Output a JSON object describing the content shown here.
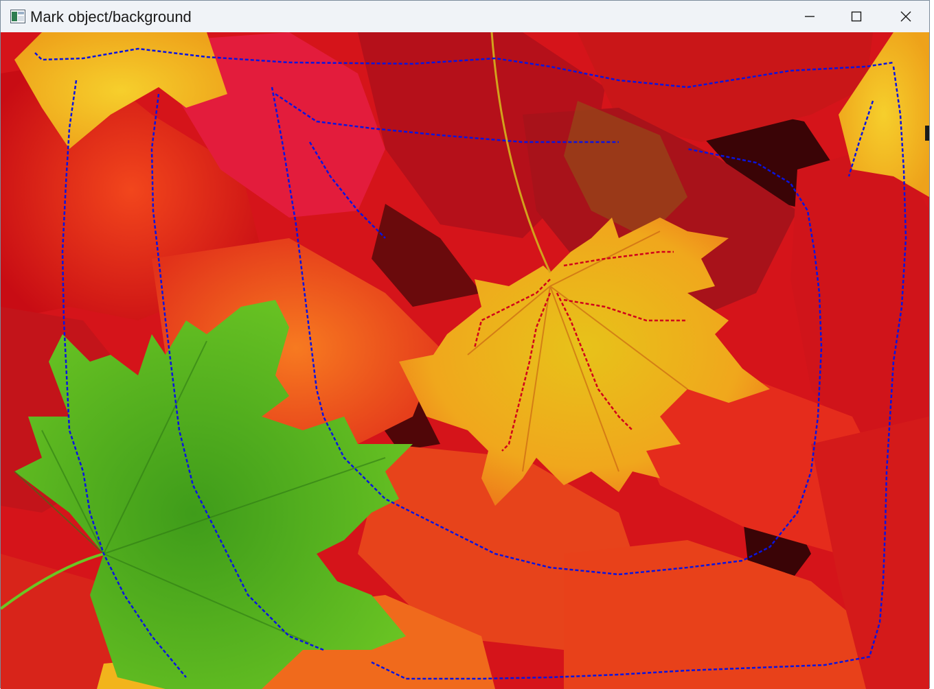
{
  "window": {
    "title": "Mark object/background",
    "controls": {
      "minimize": "minimize-icon",
      "maximize": "maximize-icon",
      "close": "close-icon"
    }
  },
  "canvas": {
    "image_subject": "autumn maple leaves",
    "marker_colors": {
      "object": "#d0001a",
      "background": "#0a14e0"
    },
    "leaf_colors": {
      "red": "#e3151a",
      "orange": "#f0541a",
      "yellow": "#f3c21a",
      "green": "#4fb21e",
      "dark": "#5a0808"
    }
  }
}
